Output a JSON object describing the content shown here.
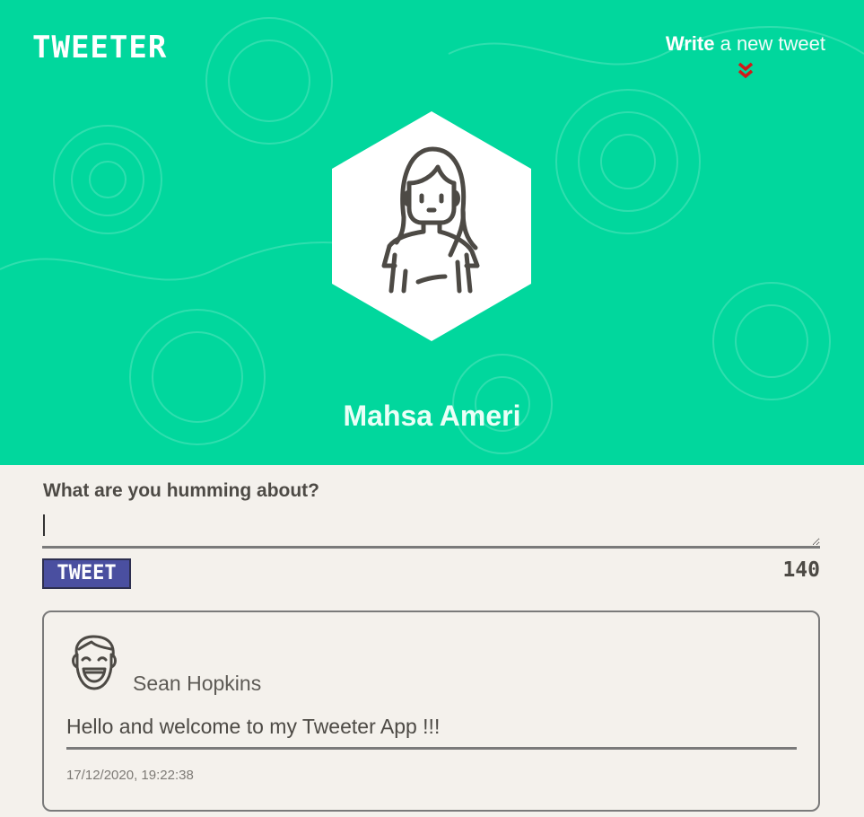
{
  "header": {
    "logo": "TWEETER",
    "write_bold": "Write",
    "write_rest": " a new tweet",
    "user_name": "Mahsa Ameri",
    "accent_color": "#01d79d"
  },
  "compose": {
    "label": "What are you humming about?",
    "value": "",
    "button_label": "TWEET",
    "char_count": "140"
  },
  "tweets": [
    {
      "author": "Sean Hopkins",
      "text": "Hello and welcome to my Tweeter App !!!",
      "timestamp": "17/12/2020, 19:22:38"
    }
  ],
  "icons": {
    "write_chevron": "double-chevron-down-icon",
    "profile_avatar": "woman-avatar-icon",
    "tweet_avatar": "laughing-man-avatar-icon"
  }
}
